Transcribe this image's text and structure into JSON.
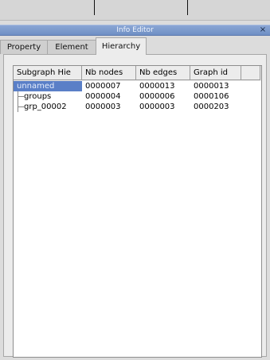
{
  "window": {
    "title": "Info Editor",
    "close_glyph": "×"
  },
  "tabs": [
    {
      "label": "Property",
      "active": false
    },
    {
      "label": "Element",
      "active": false
    },
    {
      "label": "Hierarchy",
      "active": true
    }
  ],
  "table": {
    "columns": [
      "Subgraph Hie",
      "Nb nodes",
      "Nb edges",
      "Graph id",
      ""
    ],
    "rows": [
      {
        "name": "unnamed",
        "nodes": "0000007",
        "edges": "0000013",
        "id": "0000013",
        "selected": true,
        "depth": 0
      },
      {
        "name": "groups",
        "nodes": "0000004",
        "edges": "0000006",
        "id": "0000106",
        "selected": false,
        "depth": 1
      },
      {
        "name": "grp_00002",
        "nodes": "0000003",
        "edges": "0000003",
        "id": "0000203",
        "selected": false,
        "depth": 1
      }
    ]
  },
  "colors": {
    "selection": "#5a7fc7",
    "title_bar": "#7f9bcf"
  }
}
